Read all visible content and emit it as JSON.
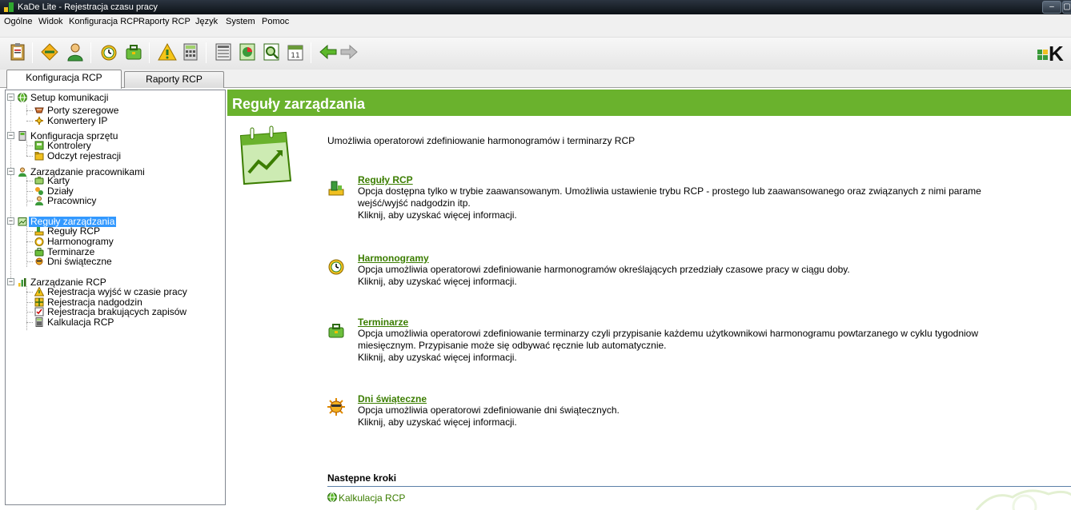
{
  "window": {
    "title": "KaDe Lite - Rejestracja czasu pracy"
  },
  "menu": [
    "Ogólne",
    "Widok",
    "Konfiguracja RCP",
    "Raporty RCP",
    "Język",
    "System",
    "Pomoc"
  ],
  "toolbar": {
    "logo_text": "K"
  },
  "tabs": [
    {
      "label": "Konfiguracja RCP",
      "active": true
    },
    {
      "label": "Raporty RCP",
      "active": false
    }
  ],
  "tree": {
    "setup": {
      "label": "Setup komunikacji",
      "children": [
        "Porty szeregowe",
        "Konwertery IP"
      ]
    },
    "hardware": {
      "label": "Konfiguracja sprzętu",
      "children": [
        "Kontrolery",
        "Odczyt rejestracji"
      ]
    },
    "employees": {
      "label": "Zarządzanie pracownikami",
      "children": [
        "Karty",
        "Działy",
        "Pracownicy"
      ]
    },
    "rules": {
      "label": "Reguły zarządzania",
      "selected": true,
      "children": [
        "Reguły RCP",
        "Harmonogramy",
        "Terminarze",
        "Dni świąteczne"
      ]
    },
    "rcp": {
      "label": "Zarządzanie RCP",
      "children": [
        "Rejestracja wyjść w czasie pracy",
        "Rejestracja nadgodzin",
        "Rejestracja brakujących zapisów",
        "Kalkulacja RCP"
      ]
    }
  },
  "content": {
    "header": "Reguły zarządzania",
    "intro": "Umożliwia operatorowi zdefiniowanie harmonogramów i terminarzy RCP",
    "items": [
      {
        "title": "Reguły RCP",
        "lines": [
          "Opcja dostępna tylko w trybie zaawansowanym. Umożliwia ustawienie trybu RCP - prostego lub zaawansowanego oraz związanych z nimi parame",
          "wejść/wyjść nadgodzin itp.",
          "Kliknij, aby uzyskać więcej informacji."
        ]
      },
      {
        "title": "Harmonogramy",
        "lines": [
          "Opcja umożliwia operatorowi zdefiniowanie harmonogramów określających przedziały czasowe pracy w ciągu doby.",
          "Kliknij, aby uzyskać więcej informacji."
        ]
      },
      {
        "title": "Terminarze",
        "lines": [
          "Opcja umożliwia operatorowi zdefiniowanie terminarzy czyli przypisanie każdemu użytkownikowi harmonogramu powtarzanego w cyklu tygodniow",
          "miesięcznym. Przypisanie może się odbywać ręcznie lub automatycznie.",
          "Kliknij, aby uzyskać więcej informacji."
        ]
      },
      {
        "title": "Dni świąteczne",
        "lines": [
          "Opcja umożliwia operatorowi zdefiniowanie dni świątecznych.",
          "Kliknij, aby uzyskać więcej informacji."
        ]
      }
    ],
    "next_steps_title": "Następne kroki",
    "next_link": "Kalkulacja RCP"
  },
  "colors": {
    "header_green": "#6ab22d",
    "link_green": "#3b7d00",
    "selection_blue": "#3399ff"
  }
}
